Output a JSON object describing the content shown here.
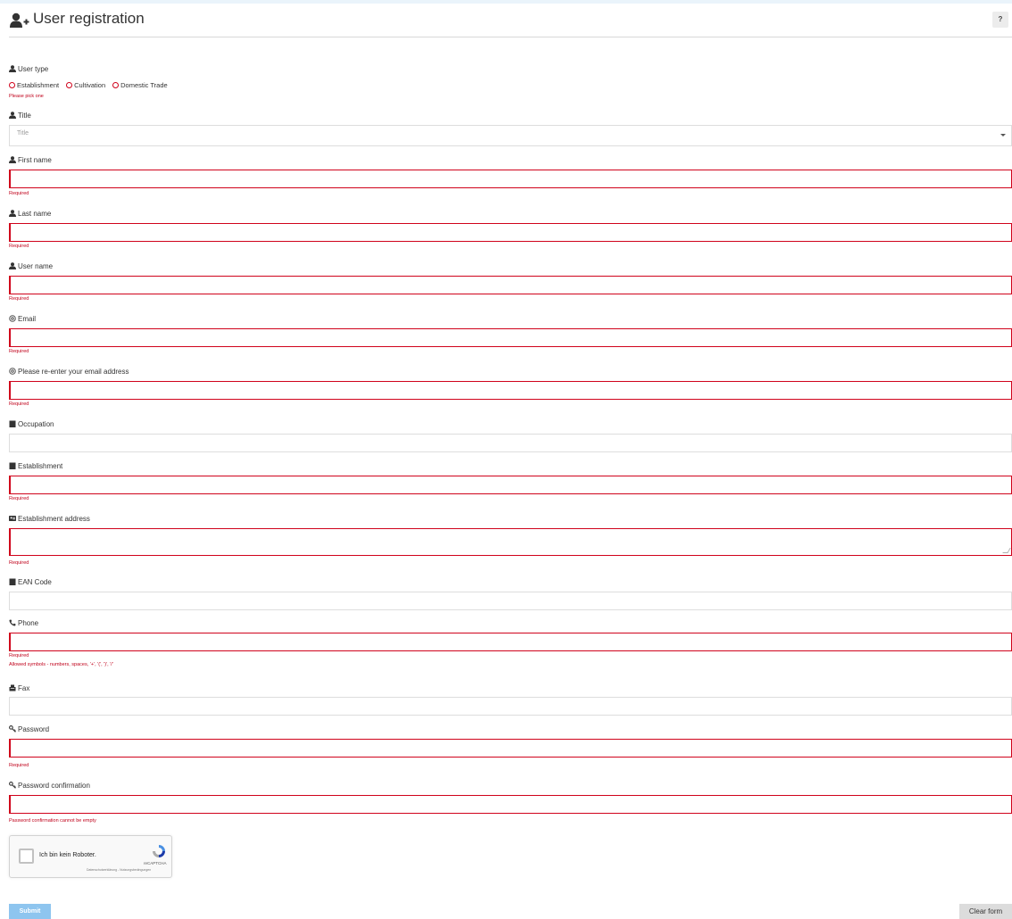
{
  "header": {
    "title": "User registration",
    "help_label": "?"
  },
  "form": {
    "user_type": {
      "label": "User type",
      "options": [
        "Establishment",
        "Cultivation",
        "Domestic Trade"
      ],
      "error": "Please pick one"
    },
    "title": {
      "label": "Title",
      "placeholder": "Title"
    },
    "first_name": {
      "label": "First name",
      "error": "Required"
    },
    "last_name": {
      "label": "Last name",
      "error": "Required"
    },
    "user_name": {
      "label": "User name",
      "error": "Required"
    },
    "email": {
      "label": "Email",
      "error": "Required"
    },
    "email_confirm": {
      "label": "Please re-enter your email address",
      "error": "Required"
    },
    "occupation": {
      "label": "Occupation"
    },
    "establishment": {
      "label": "Establishment",
      "error": "Required"
    },
    "establishment_address": {
      "label": "Establishment address",
      "error": "Required"
    },
    "ean_code": {
      "label": "EAN Code"
    },
    "phone": {
      "label": "Phone",
      "error": "Required",
      "hint": "Allowed symbols - numbers, spaces, '+', '(', ')', '/'"
    },
    "fax": {
      "label": "Fax"
    },
    "password": {
      "label": "Password",
      "error": "Required"
    },
    "password_confirm": {
      "label": "Password confirmation",
      "error": "Password confirmation cannot be empty"
    }
  },
  "captcha": {
    "label": "Ich bin kein Roboter.",
    "brand": "reCAPTCHA",
    "links": "Datenschutzerklärung - Nutzungsbedingungen"
  },
  "actions": {
    "submit_label": "Submit",
    "clear_label": "Clear form"
  },
  "colors": {
    "error": "#d0021b",
    "submit": "#8ec5ef",
    "clear": "#dcdcdc"
  }
}
